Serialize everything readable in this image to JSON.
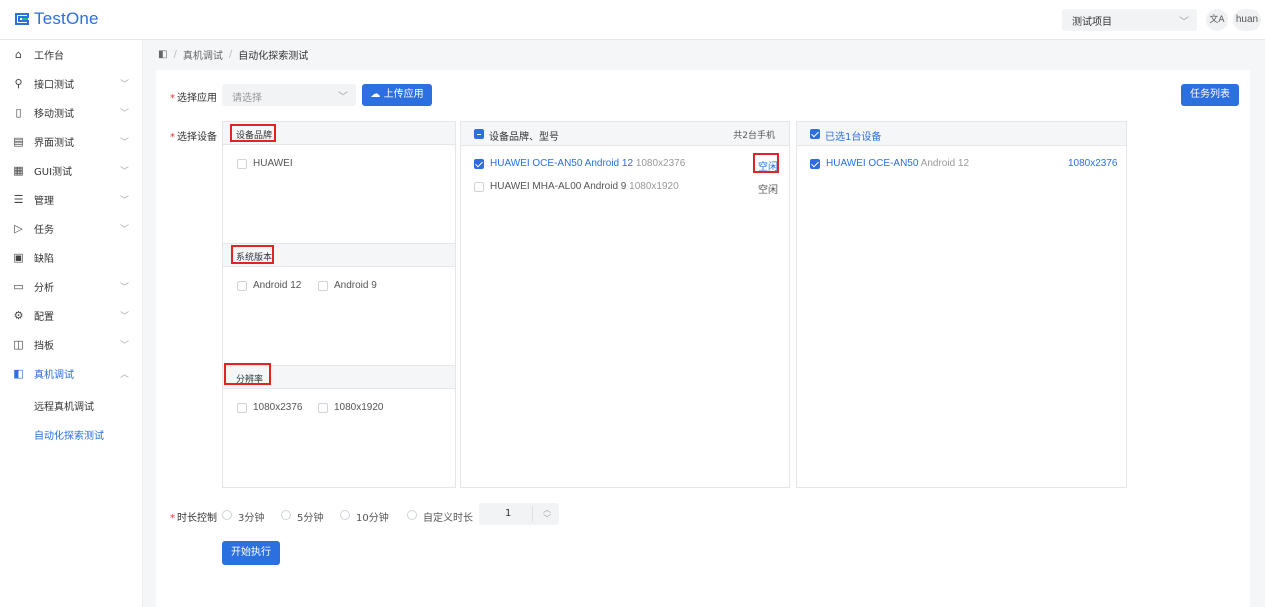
{
  "header": {
    "logo_text": "TestOne",
    "project_select_value": "测试项目",
    "lang_icon": "文A",
    "user_name": "huan"
  },
  "sidebar": {
    "items": [
      {
        "label": "工作台",
        "icon": "home-icon",
        "expandable": false
      },
      {
        "label": "接口测试",
        "icon": "api-icon",
        "expandable": true
      },
      {
        "label": "移动测试",
        "icon": "mobile-icon",
        "expandable": true
      },
      {
        "label": "界面测试",
        "icon": "layout-icon",
        "expandable": true
      },
      {
        "label": "GUI测试",
        "icon": "grid-icon",
        "expandable": true
      },
      {
        "label": "管理",
        "icon": "list-icon",
        "expandable": true
      },
      {
        "label": "任务",
        "icon": "play-icon",
        "expandable": true
      },
      {
        "label": "缺陷",
        "icon": "doc-icon",
        "expandable": false
      },
      {
        "label": "分析",
        "icon": "chart-icon",
        "expandable": true
      },
      {
        "label": "配置",
        "icon": "gear-icon",
        "expandable": true
      },
      {
        "label": "挡板",
        "icon": "panel-icon",
        "expandable": true
      },
      {
        "label": "真机调试",
        "icon": "device-icon",
        "expandable": true,
        "expanded": true
      }
    ],
    "sub_items": [
      {
        "label": "远程真机调试"
      },
      {
        "label": "自动化探索测试",
        "active": true
      }
    ]
  },
  "breadcrumb": {
    "parent": "真机调试",
    "current": "自动化探索测试",
    "separator": "/"
  },
  "form": {
    "select_app_label": "选择应用",
    "app_placeholder": "请选择",
    "upload_button": "上传应用",
    "task_list_button": "任务列表",
    "select_device_label": "选择设备",
    "duration_label": "时长控制",
    "duration_options": [
      "3分钟",
      "5分钟",
      "10分钟",
      "自定义时长"
    ],
    "custom_duration_value": "1",
    "run_button": "开始执行"
  },
  "filter_panel": {
    "brand_title": "设备品牌",
    "brands": [
      "HUAWEI"
    ],
    "os_title": "系统版本",
    "os_versions": [
      "Android 12",
      "Android 9"
    ],
    "resolution_title": "分辨率",
    "resolutions": [
      "1080x2376",
      "1080x1920"
    ]
  },
  "device_panel": {
    "title": "设备品牌、型号",
    "count_text": "共2台手机",
    "devices": [
      {
        "name": "HUAWEI OCE-AN50 Android 12",
        "resolution": "1080x2376",
        "status": "空闲",
        "checked": true
      },
      {
        "name": "HUAWEI MHA-AL00 Android 9",
        "resolution": "1080x1920",
        "status": "空闲",
        "checked": false
      }
    ]
  },
  "selected_panel": {
    "title": "已选1台设备",
    "devices": [
      {
        "name": "HUAWEI OCE-AN50",
        "os": "Android 12",
        "resolution": "1080x2376"
      }
    ]
  },
  "colors": {
    "primary": "#2b6fe0",
    "highlight": "#e02424"
  }
}
